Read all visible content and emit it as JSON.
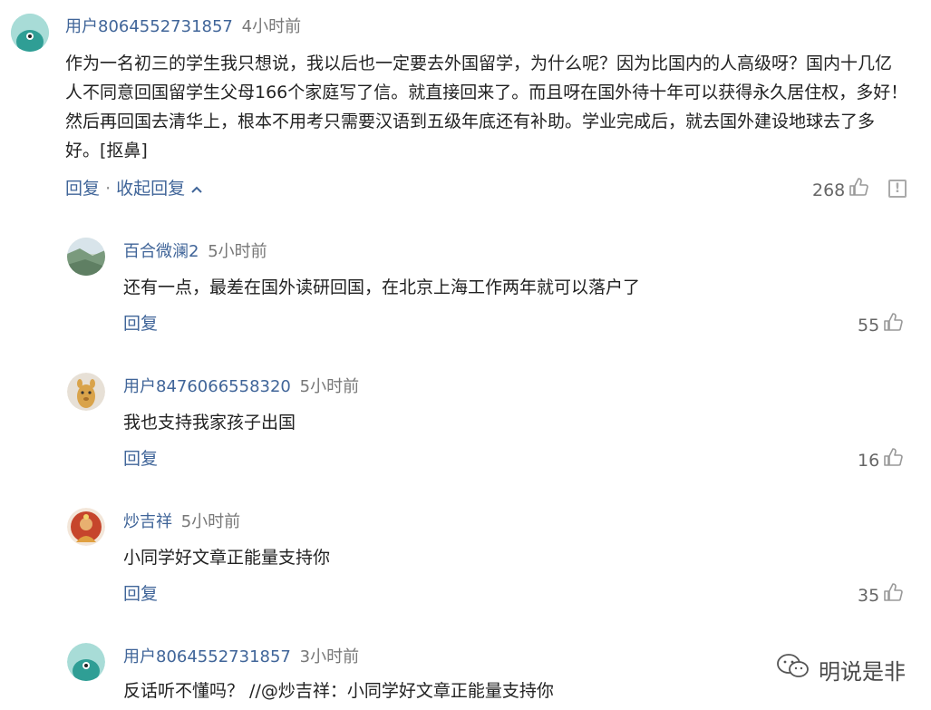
{
  "comments": [
    {
      "username": "用户8064552731857",
      "time": "4小时前",
      "text": "作为一名初三的学生我只想说，我以后也一定要去外国留学，为什么呢？因为比国内的人高级呀？国内十几亿人不同意回国留学生父母166个家庭写了信。就直接回来了。而且呀在国外待十年可以获得永久居住权，多好！然后再回国去清华上，根本不用考只需要汉语到五级年底还有补助。学业完成后，就去国外建设地球去了多好。[抠鼻]",
      "reply_label": "回复",
      "separator": "·",
      "collapse_label": "收起回复",
      "likes": "268"
    },
    {
      "username": "百合微澜2",
      "time": "5小时前",
      "text": "还有一点，最差在国外读研回国，在北京上海工作两年就可以落户了",
      "reply_label": "回复",
      "likes": "55"
    },
    {
      "username": "用户8476066558320",
      "time": "5小时前",
      "text": "我也支持我家孩子出国",
      "reply_label": "回复",
      "likes": "16"
    },
    {
      "username": "炒吉祥",
      "time": "5小时前",
      "text": "小同学好文章正能量支持你",
      "reply_label": "回复",
      "likes": "35"
    },
    {
      "username": "用户8064552731857",
      "time": "3小时前",
      "text": "反话听不懂吗？ //@炒吉祥：小同学好文章正能量支持你"
    }
  ],
  "watermark": {
    "text": "明说是非",
    "icon": "wechat-icon"
  },
  "colors": {
    "username": "#406599",
    "time": "#777777",
    "text": "#222222",
    "action": "#406599"
  }
}
